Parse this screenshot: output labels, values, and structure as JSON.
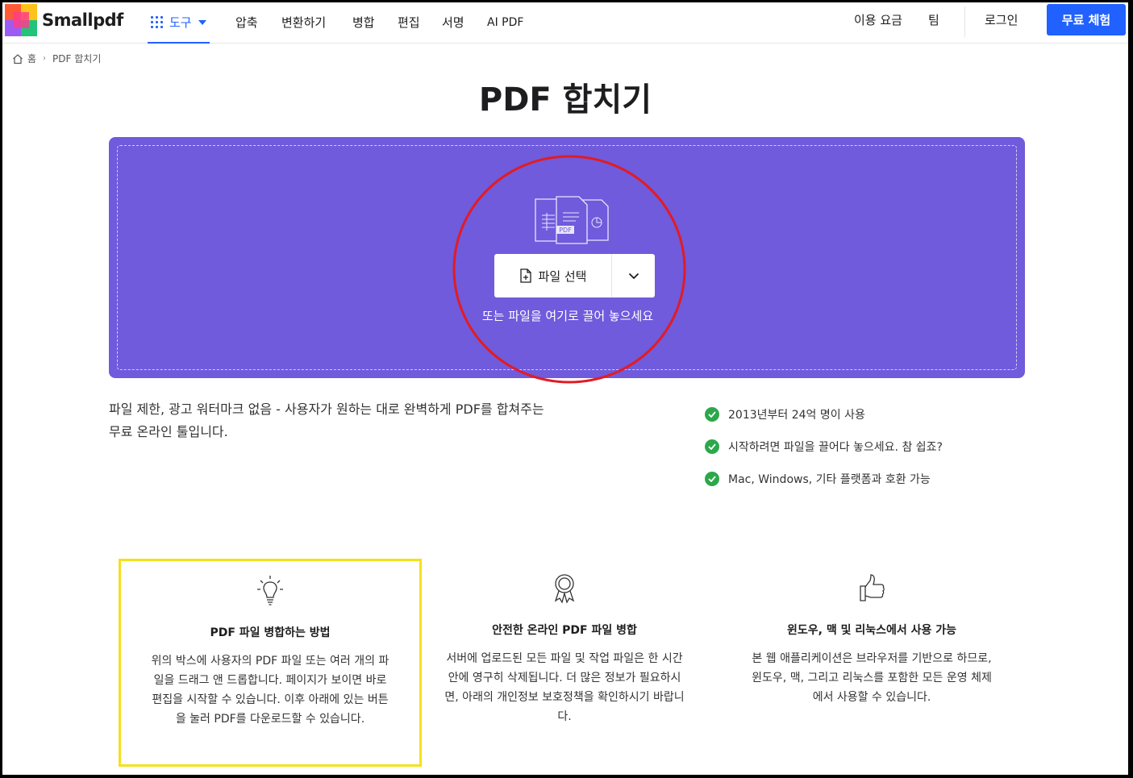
{
  "header": {
    "logo_text": "Smallpdf",
    "tools_label": "도구",
    "nav": [
      "압축",
      "변환하기",
      "병합",
      "편집",
      "서명",
      "AI PDF"
    ],
    "pricing_label": "이용 요금",
    "team_label": "팀",
    "login_label": "로그인",
    "trial_label": "무료 체험",
    "accent_color": "#2061ff"
  },
  "breadcrumb": {
    "home": "홈",
    "current": "PDF 합치기"
  },
  "page_title": "PDF 합치기",
  "dropzone": {
    "icon_label": "PDF",
    "select_label": "파일 선택",
    "hint": "또는 파일을 여기로 끌어 놓으세요",
    "background_color": "#6f5bdc"
  },
  "description": {
    "line1": "파일 제한, 광고 워터마크 없음 - 사용자가 원하는 대로 완벽하게 PDF를 합쳐주는",
    "line2": "무료 온라인 툴입니다."
  },
  "features": [
    "2013년부터 24억 명이 사용",
    "시작하려면 파일을 끌어다 놓으세요. 참 쉽죠?",
    "Mac, Windows, 기타 플랫폼과 호환 가능"
  ],
  "cards": [
    {
      "icon": "lightbulb-icon",
      "title": "PDF 파일 병합하는 방법",
      "text": "위의 박스에 사용자의 PDF 파일 또는 여러 개의 파일을 드래그 앤 드롭합니다. 페이지가 보이면 바로 편집을 시작할 수 있습니다. 이후 아래에 있는 버튼을 눌러 PDF를 다운로드할 수 있습니다."
    },
    {
      "icon": "award-ribbon-icon",
      "title": "안전한 온라인 PDF 파일 병합",
      "text": "서버에 업로드된 모든 파일 및 작업 파일은 한 시간 안에 영구히 삭제됩니다. 더 많은 정보가 필요하시면, 아래의 개인정보 보호정책을 확인하시기 바랍니다."
    },
    {
      "icon": "thumbs-up-icon",
      "title": "윈도우, 맥 및 리눅스에서 사용 가능",
      "text": "본 웹 애플리케이션은 브라우저를 기반으로 하므로, 윈도우, 맥, 그리고 리눅스를 포함한 모든 운영 체제에서 사용할 수 있습니다."
    }
  ],
  "annotations": {
    "circle_color": "#e31b23",
    "highlight_color": "#f5e11b"
  }
}
